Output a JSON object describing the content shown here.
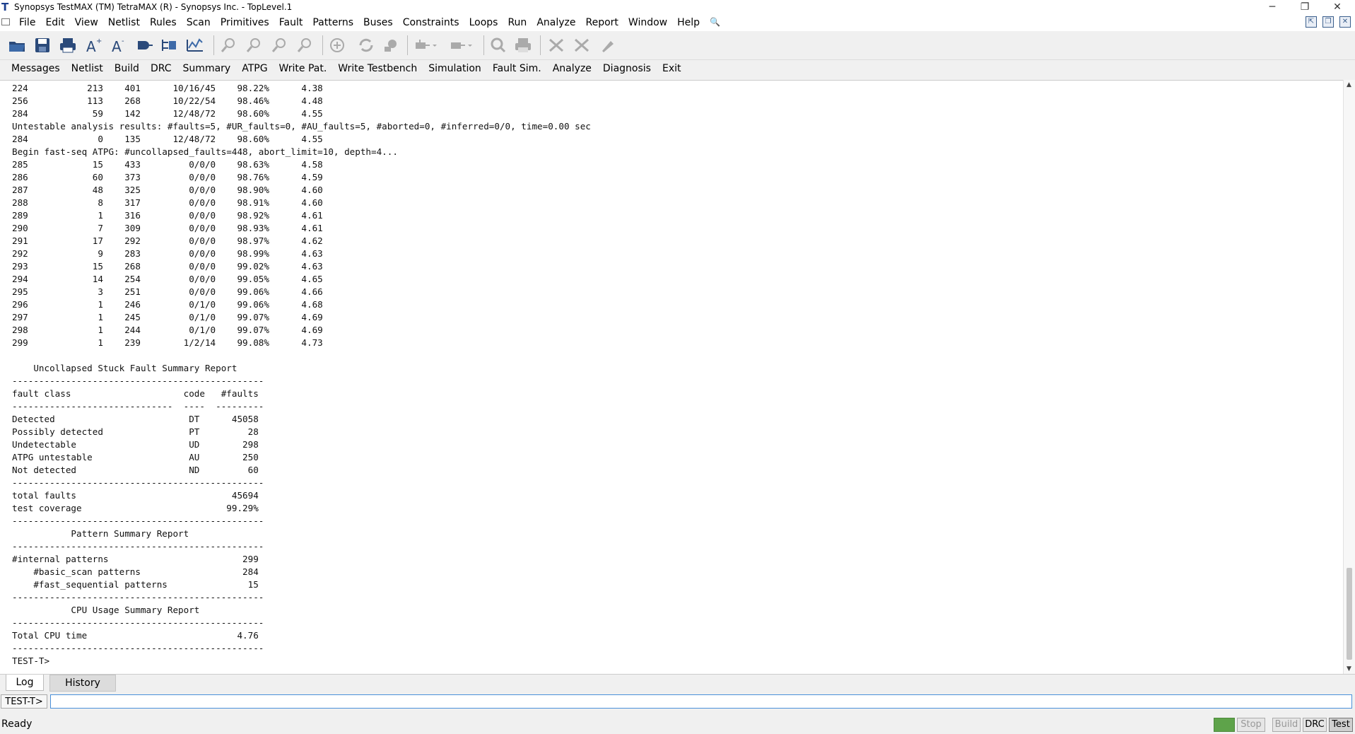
{
  "window": {
    "title": "Synopsys TestMAX (TM) TetraMAX (R) - Synopsys Inc. - TopLevel.1",
    "app_icon_letter": "T",
    "controls": {
      "minimize": "─",
      "restore": "❐",
      "close": "✕"
    }
  },
  "menu": {
    "items": [
      "File",
      "Edit",
      "View",
      "Netlist",
      "Rules",
      "Scan",
      "Primitives",
      "Fault",
      "Patterns",
      "Buses",
      "Constraints",
      "Loops",
      "Run",
      "Analyze",
      "Report",
      "Window",
      "Help"
    ],
    "search_icon": "🔍",
    "mdi": [
      "⇱",
      "❐",
      "✕"
    ]
  },
  "toolbar": {
    "icons": [
      "open-folder-icon",
      "save-icon",
      "print-icon",
      "font-larger-icon",
      "font-smaller-icon",
      "netlist-icon",
      "schematic-icon",
      "waveform-icon",
      "zoom-in-icon",
      "zoom-out-icon",
      "zoom-fit-icon",
      "zoom-area-icon",
      "zoom-full-icon",
      "refresh-icon",
      "gear-plug-icon",
      "plug-icon",
      "plug-dropdown-icon",
      "find-icon",
      "print-schematic-icon",
      "scan-chain-icon",
      "scan-trace-icon",
      "fault-tool-icon"
    ]
  },
  "command_bar": {
    "items": [
      "Messages",
      "Netlist",
      "Build",
      "DRC",
      "Summary",
      "ATPG",
      "Write Pat.",
      "Write Testbench",
      "Simulation",
      "Fault Sim.",
      "Analyze",
      "Diagnosis",
      "Exit"
    ]
  },
  "transcript": {
    "lines": [
      "224           213    401      10/16/45    98.22%      4.38",
      "256           113    268      10/22/54    98.46%      4.48",
      "284            59    142      12/48/72    98.60%      4.55",
      "Untestable analysis results: #faults=5, #UR_faults=0, #AU_faults=5, #aborted=0, #inferred=0/0, time=0.00 sec",
      "284             0    135      12/48/72    98.60%      4.55",
      "Begin fast-seq ATPG: #uncollapsed_faults=448, abort_limit=10, depth=4...",
      "285            15    433         0/0/0    98.63%      4.58",
      "286            60    373         0/0/0    98.76%      4.59",
      "287            48    325         0/0/0    98.90%      4.60",
      "288             8    317         0/0/0    98.91%      4.60",
      "289             1    316         0/0/0    98.92%      4.61",
      "290             7    309         0/0/0    98.93%      4.61",
      "291            17    292         0/0/0    98.97%      4.62",
      "292             9    283         0/0/0    98.99%      4.63",
      "293            15    268         0/0/0    99.02%      4.63",
      "294            14    254         0/0/0    99.05%      4.65",
      "295             3    251         0/0/0    99.06%      4.66",
      "296             1    246         0/1/0    99.06%      4.68",
      "297             1    245         0/1/0    99.07%      4.69",
      "298             1    244         0/1/0    99.07%      4.69",
      "299             1    239        1/2/14    99.08%      4.73",
      "",
      "    Uncollapsed Stuck Fault Summary Report",
      "-----------------------------------------------",
      "fault class                     code   #faults",
      "------------------------------  ----  ---------",
      "Detected                         DT      45058",
      "Possibly detected                PT         28",
      "Undetectable                     UD        298",
      "ATPG untestable                  AU        250",
      "Not detected                     ND         60",
      "-----------------------------------------------",
      "total faults                             45694",
      "test coverage                           99.29%",
      "-----------------------------------------------",
      "           Pattern Summary Report",
      "-----------------------------------------------",
      "#internal patterns                         299",
      "    #basic_scan patterns                   284",
      "    #fast_sequential patterns               15",
      "-----------------------------------------------",
      "           CPU Usage Summary Report",
      "-----------------------------------------------",
      "Total CPU time                            4.76",
      "-----------------------------------------------",
      "TEST-T>"
    ]
  },
  "tabs": {
    "log": "Log",
    "history": "History",
    "active": "Log"
  },
  "command_line": {
    "prompt": "TEST-T>",
    "value": ""
  },
  "status": {
    "text": "Ready",
    "buttons": [
      "Stop",
      "Build",
      "DRC",
      "Test"
    ],
    "indicator_color": "#5ea34a"
  }
}
